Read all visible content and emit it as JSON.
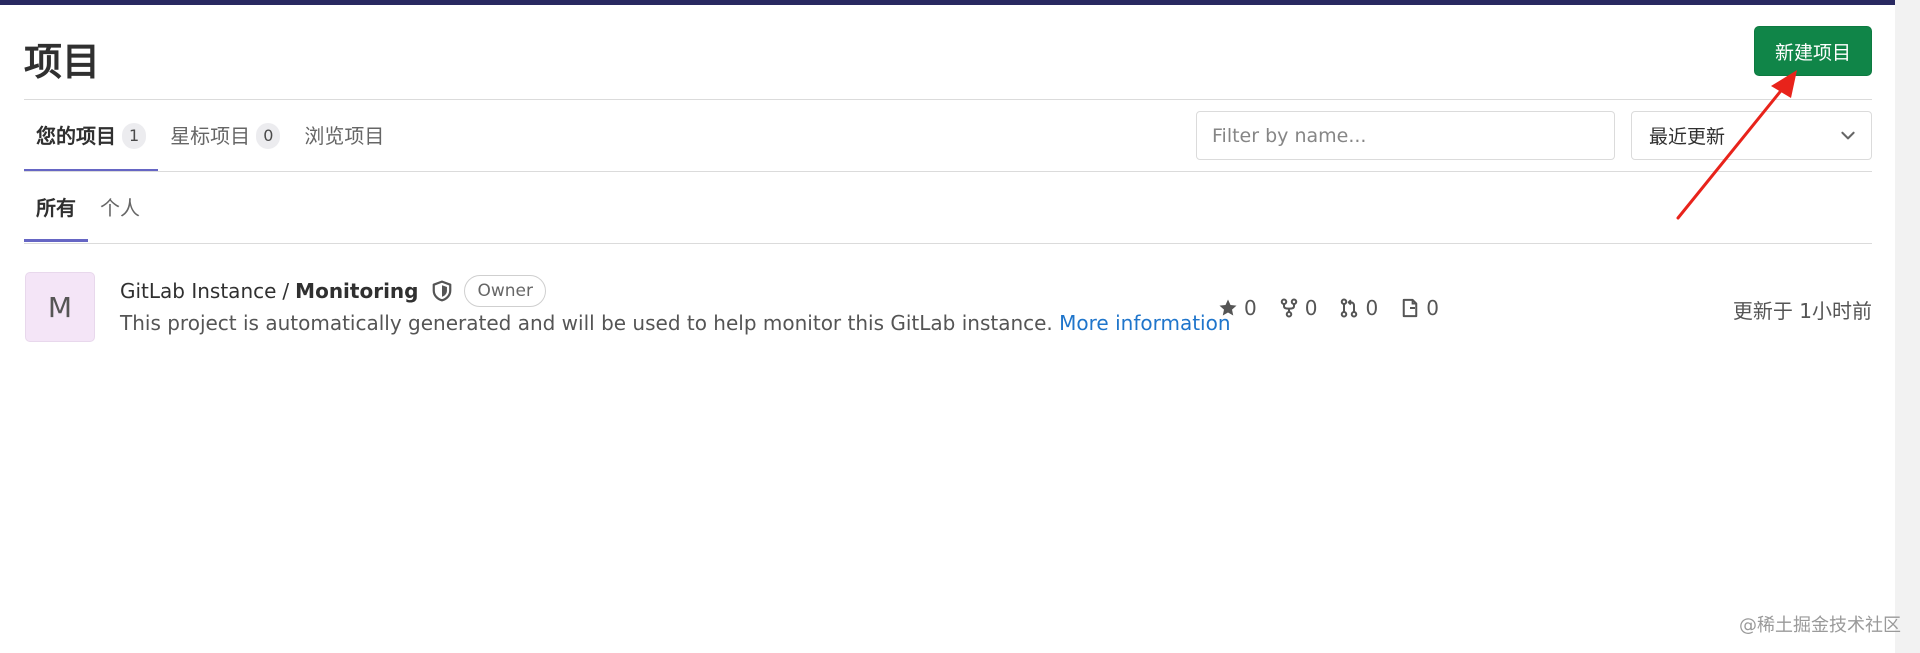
{
  "header": {
    "title": "项目",
    "new_project_label": "新建项目"
  },
  "tabs": [
    {
      "label": "您的项目",
      "count": "1",
      "active": true
    },
    {
      "label": "星标项目",
      "count": "0",
      "active": false
    },
    {
      "label": "浏览项目",
      "active": false
    }
  ],
  "filter": {
    "placeholder": "Filter by name...",
    "value": ""
  },
  "sort": {
    "selected": "最近更新"
  },
  "subtabs": [
    {
      "label": "所有",
      "active": true
    },
    {
      "label": "个人",
      "active": false
    }
  ],
  "project": {
    "avatar_letter": "M",
    "namespace": "GitLab Instance",
    "separator": "/",
    "name": "Monitoring",
    "role_badge": "Owner",
    "description": "This project is automatically generated and will be used to help monitor this GitLab instance.",
    "more_info_link": "More information",
    "stats": {
      "stars": "0",
      "forks": "0",
      "merge_requests": "0",
      "issues": "0"
    },
    "updated": "更新于 1小时前"
  },
  "watermark": "@稀土掘金技术社区",
  "colors": {
    "topbar": "#292961",
    "primary_button": "#108548",
    "tab_underline": "#6666c4",
    "link": "#1f75cb",
    "annotation_arrow": "#e8231b"
  },
  "icons": [
    "shield-icon",
    "star-icon",
    "fork-icon",
    "merge-request-icon",
    "issues-icon",
    "chevron-down-icon"
  ]
}
